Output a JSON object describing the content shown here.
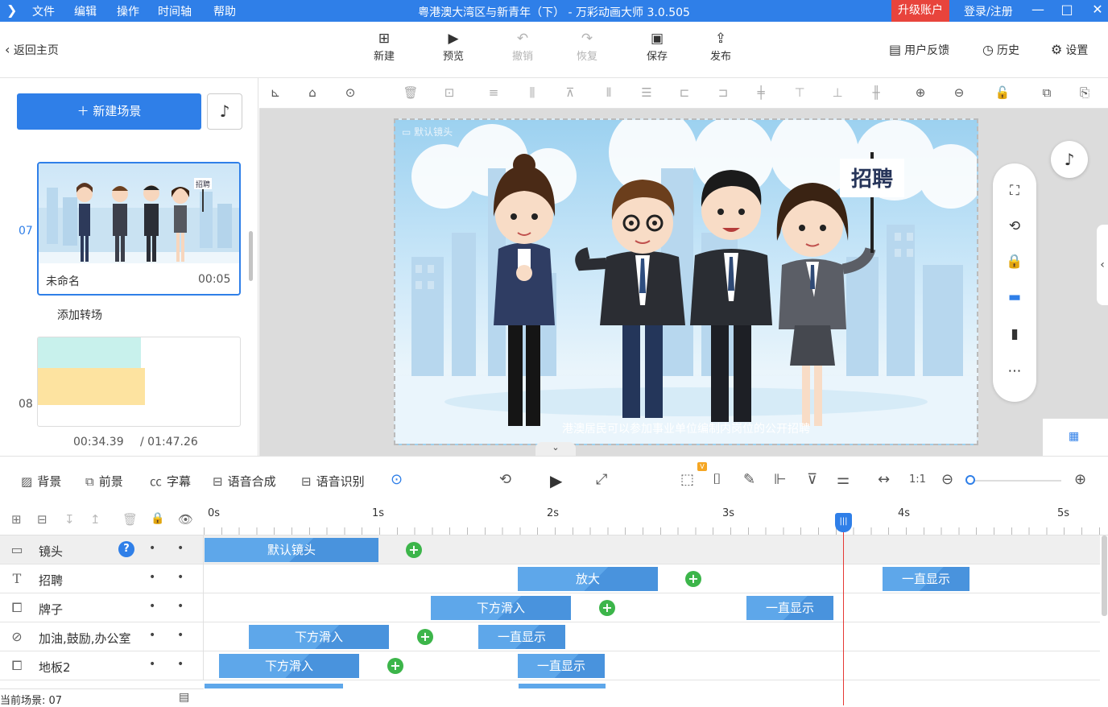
{
  "app": {
    "menu": [
      "文件",
      "编辑",
      "操作",
      "时间轴",
      "帮助"
    ],
    "window_title": "粤港澳大湾区与新青年（下） - 万彩动画大师 3.0.505",
    "upgrade_label": "升级账户",
    "login_label": "登录/注册",
    "accent": "#2f7fe8"
  },
  "toolbar": {
    "back_label": "返回主页",
    "buttons": [
      {
        "label": "新建",
        "icon": "plus-square-icon"
      },
      {
        "label": "预览",
        "icon": "play-icon"
      },
      {
        "label": "撤销",
        "icon": "undo-icon"
      },
      {
        "label": "恢复",
        "icon": "redo-icon"
      },
      {
        "label": "保存",
        "icon": "save-icon"
      },
      {
        "label": "发布",
        "icon": "publish-icon"
      }
    ],
    "feedback_label": "用户反馈",
    "history_label": "历史",
    "settings_label": "设置"
  },
  "scenes": {
    "new_scene_label": "新建场景",
    "scene7": {
      "number": "07",
      "name": "未命名",
      "duration": "00:05",
      "sign": "招聘"
    },
    "add_transition_label": "添加转场",
    "scene8": {
      "number": "08"
    },
    "time_current": "00:34.39",
    "time_total": "/ 01:47.26"
  },
  "canvas": {
    "camera_label": "默认镜头",
    "sign_text": "招聘",
    "subtitle": "港澳居民可以参加事业单位编制内岗位的公开招聘"
  },
  "controls": {
    "background_label": "背景",
    "foreground_label": "前景",
    "caption_label": "字幕",
    "tts_label": "语音合成",
    "asr_label": "语音识别"
  },
  "timeline": {
    "ticks": [
      "0s",
      "1s",
      "2s",
      "3s",
      "4s",
      "5s"
    ],
    "rows": [
      {
        "name": "镜头",
        "icon": "camera-icon",
        "blocks": [
          {
            "label": "默认镜头"
          }
        ]
      },
      {
        "name": "招聘",
        "icon": "text-icon",
        "blocks": [
          {
            "label": "放大"
          },
          {
            "label": "一直显示"
          }
        ]
      },
      {
        "name": "牌子",
        "icon": "image-icon",
        "blocks": [
          {
            "label": "下方滑入"
          },
          {
            "label": "一直显示"
          }
        ]
      },
      {
        "name": "加油,鼓励,办公室",
        "icon": "svg-icon",
        "blocks": [
          {
            "label": "下方滑入"
          },
          {
            "label": "一直显示"
          }
        ]
      },
      {
        "name": "地板2",
        "icon": "image-icon",
        "blocks": [
          {
            "label": "下方滑入"
          },
          {
            "label": "一直显示"
          }
        ]
      }
    ],
    "status": "当前场景: 07"
  }
}
